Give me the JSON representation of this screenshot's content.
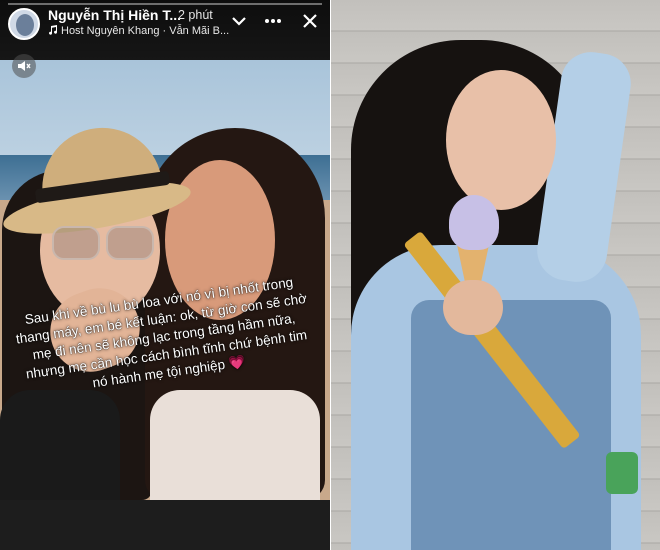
{
  "story": {
    "poster_name": "Nguyễn Thị Hiền T...",
    "time_ago": "2 phút",
    "host_line": "Host Nguyên Khang · Vẫn Mãi B...",
    "caption": "Sau khi về bù lu bù loa với nó vì bị nhốt trong thang máy, em bé kết luận: ok, từ giờ con sẽ chờ mẹ đi nên sẽ không lạc trong tầng hầm nữa, nhưng mẹ cần học cách bình tĩnh chứ bệnh tim nó hành mẹ tội nghiệp 💗",
    "icons": {
      "avatar": "avatar",
      "music": "music-note-icon",
      "collapse": "chevron-down-icon",
      "more": "more-options-icon",
      "close": "close-icon",
      "mute": "speaker-muted-icon"
    }
  }
}
